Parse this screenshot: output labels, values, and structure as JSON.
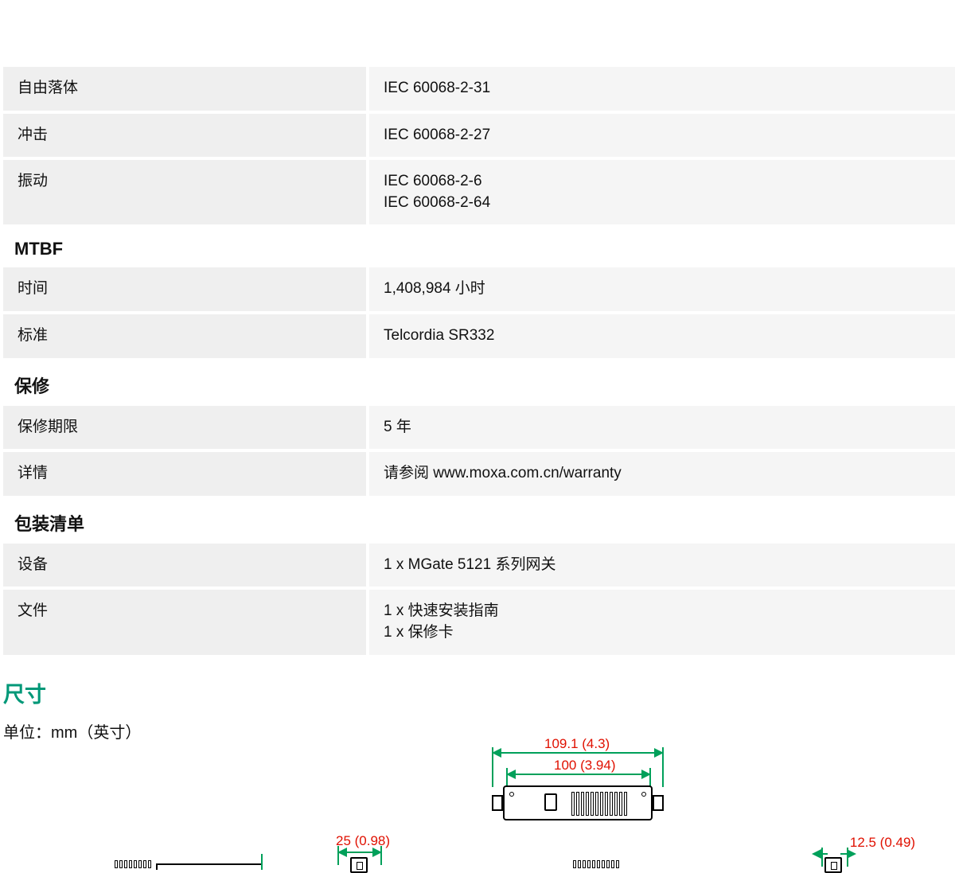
{
  "specs": {
    "rows_top": [
      {
        "label": "自由落体",
        "value": "IEC 60068-2-31"
      },
      {
        "label": "冲击",
        "value": "IEC 60068-2-27"
      },
      {
        "label": "振动",
        "value": "IEC 60068-2-6\nIEC 60068-2-64"
      }
    ],
    "section_mtbf": "MTBF",
    "rows_mtbf": [
      {
        "label": "时间",
        "value": "1,408,984 小时"
      },
      {
        "label": "标准",
        "value": "Telcordia SR332"
      }
    ],
    "section_warranty": "保修",
    "rows_warranty": [
      {
        "label": "保修期限",
        "value": "5 年"
      },
      {
        "label": "详情",
        "value": "请参阅 www.moxa.com.cn/warranty"
      }
    ],
    "section_package": "包装清单",
    "rows_package": [
      {
        "label": "设备",
        "value": "1 x MGate 5121 系列网关"
      },
      {
        "label": "文件",
        "value": "1 x 快速安装指南\n1 x 保修卡"
      }
    ]
  },
  "dimensions": {
    "heading": "尺寸",
    "unit_label": "单位：mm（英寸）",
    "d_outer": "109.1 (4.3)",
    "d_inner": "100 (3.94)",
    "d_left_small": "25 (0.98)",
    "d_right_small": "12.5 (0.49)"
  }
}
